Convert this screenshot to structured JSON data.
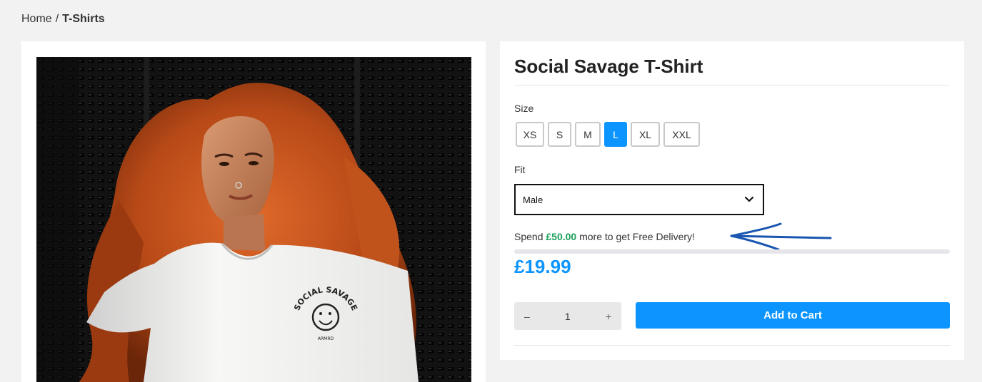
{
  "breadcrumb": {
    "home": "Home",
    "separator": "/",
    "current": "T-Shirts"
  },
  "product": {
    "title": "Social Savage T-Shirt",
    "image_alt": "Model with long red curly hair wearing a white Social Savage T-Shirt",
    "tee_print": {
      "line1": "SOCIAL SAVAGE",
      "line2": "ARMRD"
    },
    "price": "£19.99"
  },
  "size": {
    "label": "Size",
    "options": [
      "XS",
      "S",
      "M",
      "L",
      "XL",
      "XXL"
    ],
    "selected": "L"
  },
  "fit": {
    "label": "Fit",
    "value": "Male",
    "icon": "chevron-down-icon"
  },
  "delivery": {
    "prefix": "Spend",
    "amount": "£50.00",
    "suffix": "more to get Free Delivery!",
    "progress": 0
  },
  "quantity": {
    "minus": "–",
    "value": "1",
    "plus": "+"
  },
  "cart": {
    "add_label": "Add to Cart"
  },
  "annotation": {
    "icon": "hand-drawn-arrow-icon",
    "color": "#1a56b0"
  },
  "colors": {
    "accent": "#0d95ff",
    "money_green": "#19a05a",
    "page_bg": "#f2f2f2"
  }
}
